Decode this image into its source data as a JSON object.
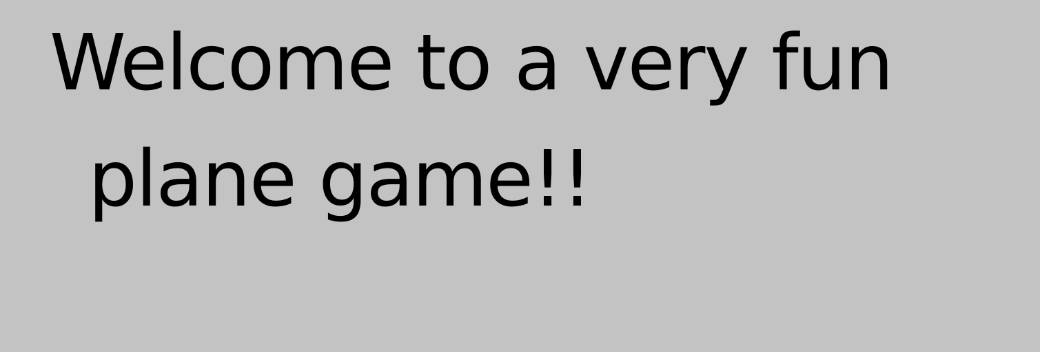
{
  "screen": {
    "background_color": "#c3c3c3",
    "text_color": "#000000"
  },
  "welcome": {
    "line1": "Welcome to a very fun",
    "line2": "plane game!!"
  }
}
